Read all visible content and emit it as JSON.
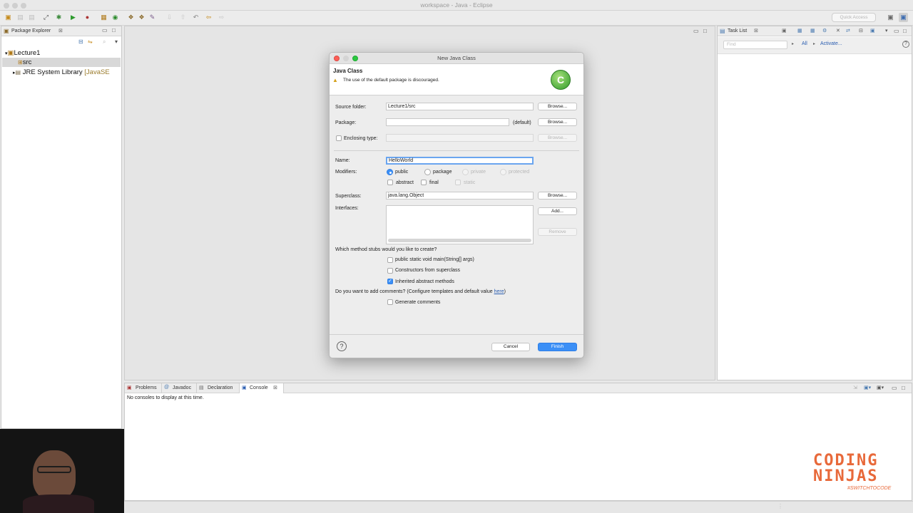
{
  "window": {
    "title": "workspace - Java - Eclipse"
  },
  "quick_access": {
    "placeholder": "Quick Access"
  },
  "package_explorer": {
    "tab_label": "Package Explorer",
    "tree": {
      "project": "Lecture1",
      "src": "src",
      "library": "JRE System Library",
      "library_suffix": "[JavaSE"
    }
  },
  "task_list": {
    "tab_label": "Task List",
    "find_placeholder": "Find",
    "all_label": "All",
    "activate_label": "Activate..."
  },
  "bottom_panel": {
    "tabs": [
      "Problems",
      "Javadoc",
      "Declaration",
      "Console"
    ],
    "message": "No consoles to display at this time."
  },
  "dialog": {
    "title": "New Java Class",
    "heading": "Java Class",
    "warning": "The use of the default package is discouraged.",
    "source_folder": {
      "label": "Source folder:",
      "value": "Lecture1/src",
      "button": "Browse..."
    },
    "package": {
      "label": "Package:",
      "value": "",
      "default_text": "(default)",
      "button": "Browse..."
    },
    "enclosing_type": {
      "label": "Enclosing type:",
      "value": "",
      "button": "Browse..."
    },
    "name": {
      "label": "Name:",
      "value": "HelloWorld"
    },
    "modifiers": {
      "label": "Modifiers:",
      "public": "public",
      "package": "package",
      "private": "private",
      "protected": "protected",
      "abstract": "abstract",
      "final": "final",
      "static": "static",
      "selected": "public"
    },
    "superclass": {
      "label": "Superclass:",
      "value": "java.lang.Object",
      "button": "Browse..."
    },
    "interfaces": {
      "label": "Interfaces:",
      "add": "Add...",
      "remove": "Remove"
    },
    "stubs": {
      "question": "Which method stubs would you like to create?",
      "main": "public static void main(String[] args)",
      "constructors": "Constructors from superclass",
      "inherited": "Inherited abstract methods",
      "checked": [
        "inherited"
      ]
    },
    "comments": {
      "question_prefix": "Do you want to add comments? (Configure templates and default value ",
      "link": "here",
      "question_suffix": ")",
      "generate": "Generate comments"
    },
    "cancel": "Cancel",
    "finish": "Finish"
  },
  "watermark": {
    "line1": "CODING",
    "line2": "NINJAS",
    "tagline": "#SWITCHTOCODE",
    "color": "#e8693a"
  }
}
